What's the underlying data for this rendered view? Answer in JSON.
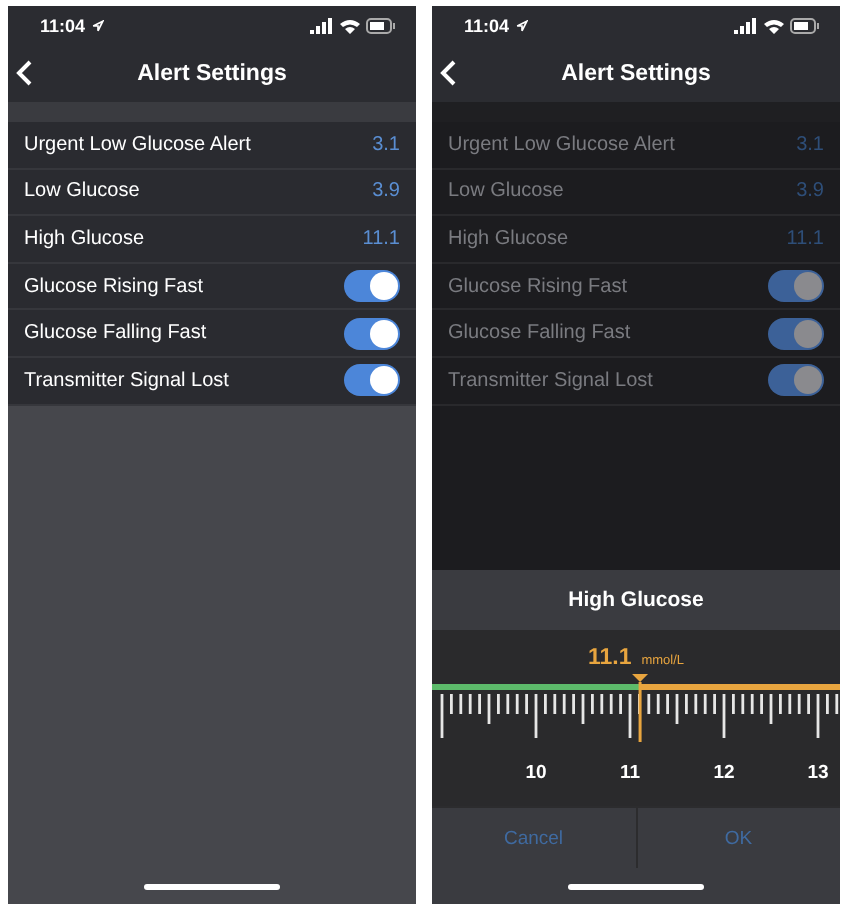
{
  "screens": [
    {
      "dimmed": false,
      "status_bar": {
        "time": "11:04"
      },
      "nav": {
        "title": "Alert Settings"
      },
      "settings": [
        {
          "label": "Urgent Low Glucose Alert",
          "kind": "value",
          "value": "3.1"
        },
        {
          "label": "Low Glucose",
          "kind": "value",
          "value": "3.9"
        },
        {
          "label": "High Glucose",
          "kind": "value",
          "value": "11.1"
        },
        {
          "label": "Glucose Rising Fast",
          "kind": "toggle",
          "on": true
        },
        {
          "label": "Glucose Falling Fast",
          "kind": "toggle",
          "on": true
        },
        {
          "label": "Transmitter Signal Lost",
          "kind": "toggle",
          "on": true
        }
      ]
    },
    {
      "dimmed": true,
      "status_bar": {
        "time": "11:04"
      },
      "nav": {
        "title": "Alert Settings"
      },
      "settings": [
        {
          "label": "Urgent Low Glucose Alert",
          "kind": "value",
          "value": "3.1"
        },
        {
          "label": "Low Glucose",
          "kind": "value",
          "value": "3.9"
        },
        {
          "label": "High Glucose",
          "kind": "value",
          "value": "11.1"
        },
        {
          "label": "Glucose Rising Fast",
          "kind": "toggle",
          "on": true
        },
        {
          "label": "Glucose Falling Fast",
          "kind": "toggle",
          "on": true
        },
        {
          "label": "Transmitter Signal Lost",
          "kind": "toggle",
          "on": true
        }
      ],
      "dialog": {
        "title": "High Glucose",
        "reading": "11.1",
        "unit": "mmol/L",
        "level": 0.51,
        "scale_labels": [
          "10",
          "11",
          "12",
          "13"
        ],
        "buttons": [
          "Cancel",
          "OK"
        ]
      }
    }
  ]
}
